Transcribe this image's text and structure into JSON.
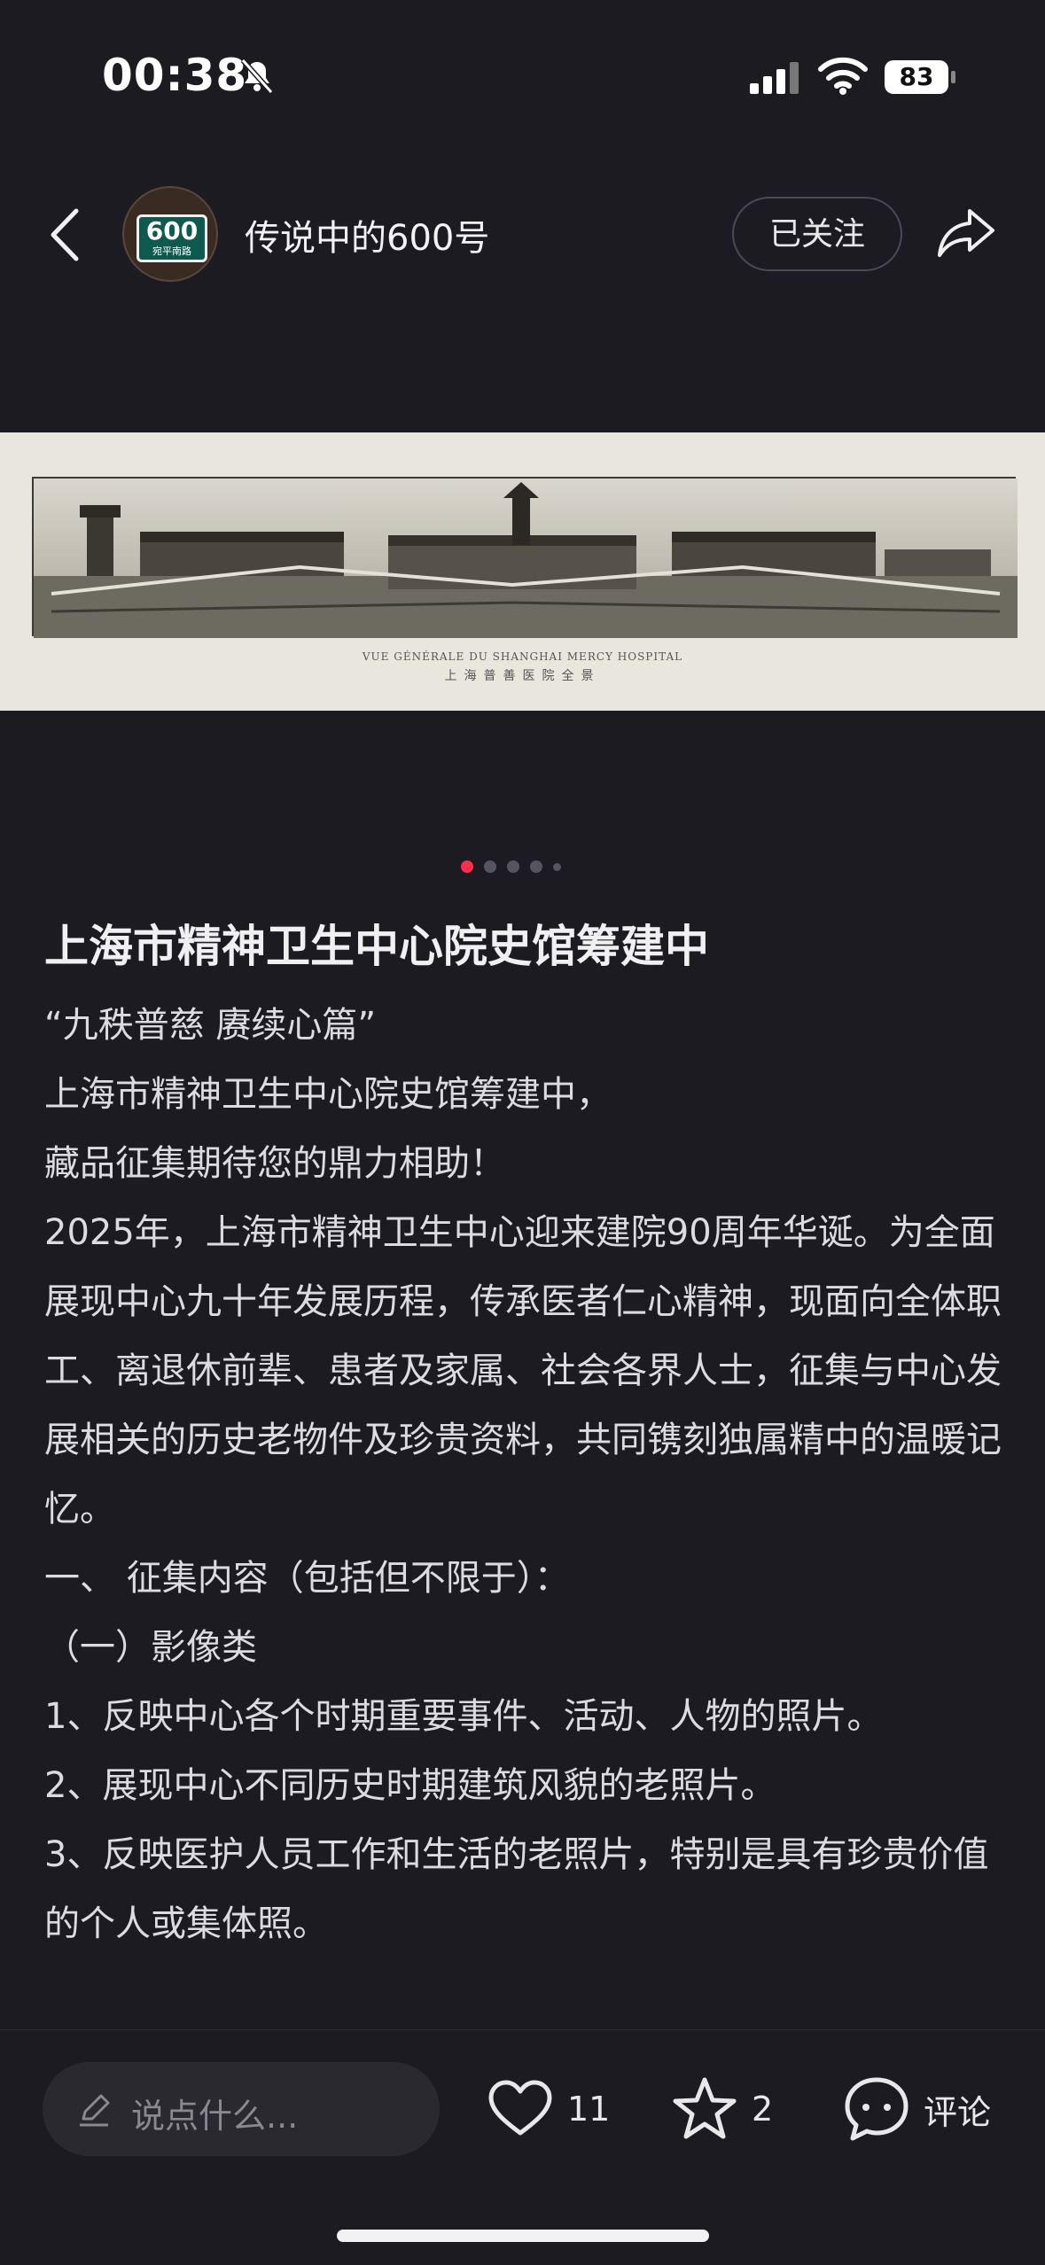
{
  "status_bar": {
    "time": "00:38",
    "battery": "83",
    "icons": [
      "bell-muted-icon",
      "cellular-signal-icon",
      "wifi-icon",
      "battery-icon"
    ]
  },
  "nav": {
    "avatar_number": "600",
    "avatar_sub": "宛平南路",
    "author": "传说中的600号",
    "follow_label": "已关注"
  },
  "photo": {
    "caption_fr": "VUE GÉNÉRALE DU SHANGHAI MERCY HOSPITAL",
    "caption_cn": "上海普善医院全景"
  },
  "carousel": {
    "total": 5,
    "active": 0
  },
  "post": {
    "title": "上海市精神卫生中心院史馆筹建中",
    "paragraphs": [
      "“九秩普慈 赓续心篇”",
      "上海市精神卫生中心院史馆筹建中，",
      "藏品征集期待您的鼎力相助！",
      "2025年，上海市精神卫生中心迎来建院90周年华诞。为全面展现中心九十年发展历程，传承医者仁心精神，现面向全体职工、离退休前辈、患者及家属、社会各界人士，征集与中心发展相关的历史老物件及珍贵资料，共同镌刻独属精中的温暖记忆。",
      "一、 征集内容（包括但不限于）：",
      "（一）影像类",
      "1、反映中心各个时期重要事件、活动、人物的照片。",
      "2、展现中心不同历史时期建筑风貌的老照片。",
      "3、反映医护人员工作和生活的老照片，特别是具有珍贵价值的个人或集体照。"
    ]
  },
  "bottom_bar": {
    "input_placeholder": "说点什么...",
    "likes": "11",
    "stars": "2",
    "comment_label": "评论"
  },
  "colors": {
    "background": "#1c1b22",
    "accent_dot": "#ff2e4d",
    "text": "#dcdce0"
  }
}
